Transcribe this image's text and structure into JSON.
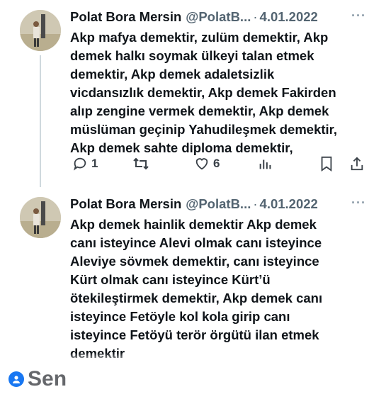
{
  "tweets": [
    {
      "author_name": "Polat Bora Mersin",
      "author_handle": "@PolatB...",
      "separator": "·",
      "date": "4.01.2022",
      "more_label": "···",
      "lines": [
        "Akp mafya demektir, zulüm demektir, Akp",
        "demek halkı soymak ülkeyi talan etmek",
        "demektir, Akp demek adaletsizlik",
        "vicdansızlık demektir, Akp demek Fakirden",
        "alıp zengine vermek demektir, Akp demek",
        "müslüman geçinip Yahudileşmek demektir,",
        "Akp demek sahte diploma demektir,"
      ],
      "actions": {
        "reply_count": "1",
        "retweet_count": "",
        "like_count": "6"
      }
    },
    {
      "author_name": "Polat Bora Mersin",
      "author_handle": "@PolatB...",
      "separator": "·",
      "date": "4.01.2022",
      "more_label": "···",
      "lines": [
        "Akp demek hainlik demektir  Akp demek",
        "canı isteyince Alevi olmak canı isteyince",
        "Aleviye sövmek demektir, canı isteyince",
        "Kürt olmak canı isteyince Kürt’ü",
        "ötekileştirmek demektir, Akp demek canı",
        "isteyince Fetöyle kol kola girip canı",
        "isteyince Fetöyü terör örgütü ilan etmek",
        "demektir"
      ]
    }
  ],
  "footer": {
    "label": "Sen",
    "accent": "#1877f2"
  },
  "icons": [
    "reply-icon",
    "retweet-icon",
    "like-icon",
    "views-icon",
    "bookmark-icon",
    "share-icon",
    "more-icon",
    "sen-badge-icon"
  ]
}
